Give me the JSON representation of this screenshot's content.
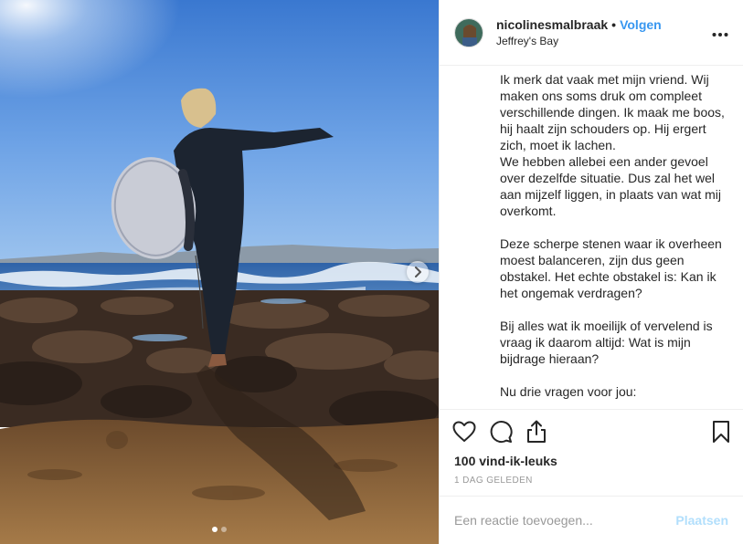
{
  "post": {
    "username": "nicolinesmalbraak",
    "separator": "•",
    "follow_label": "Volgen",
    "location": "Jeffrey's Bay",
    "more_icon": "more-horizontal-icon",
    "caption_paragraphs": [
      "Ik merk dat vaak met mijn vriend. Wij maken ons soms druk om compleet verschillende dingen. Ik maak me boos, hij haalt zijn schouders op. Hij ergert zich, moet ik lachen.\nWe hebben allebei een ander gevoel over dezelfde situatie. Dus zal het wel aan mijzelf liggen, in plaats van wat mij overkomt.",
      "Deze scherpe stenen waar ik overheen moest balanceren, zijn dus geen obstakel. Het echte obstakel is: Kan ik het ongemak verdragen?",
      "Bij alles wat ik moeilijk of vervelend is vraag ik daarom altijd: Wat is mijn bijdrage hieraan?",
      "Nu drie vragen voor jou:"
    ],
    "likes_text": "100 vind-ik-leuks",
    "timestamp": "1 DAG GELEDEN",
    "comment_placeholder": "Een reactie toevoegen...",
    "post_button_label": "Plaatsen",
    "carousel": {
      "total_slides": 2,
      "current_slide": 1
    }
  },
  "icons": {
    "like": "heart-icon",
    "comment": "comment-bubble-icon",
    "share": "share-icon",
    "save": "bookmark-icon",
    "next": "chevron-right-icon"
  },
  "colors": {
    "follow": "#3897f0",
    "post_button_disabled": "#b2dffc",
    "muted": "#999999",
    "border": "#efefef"
  }
}
